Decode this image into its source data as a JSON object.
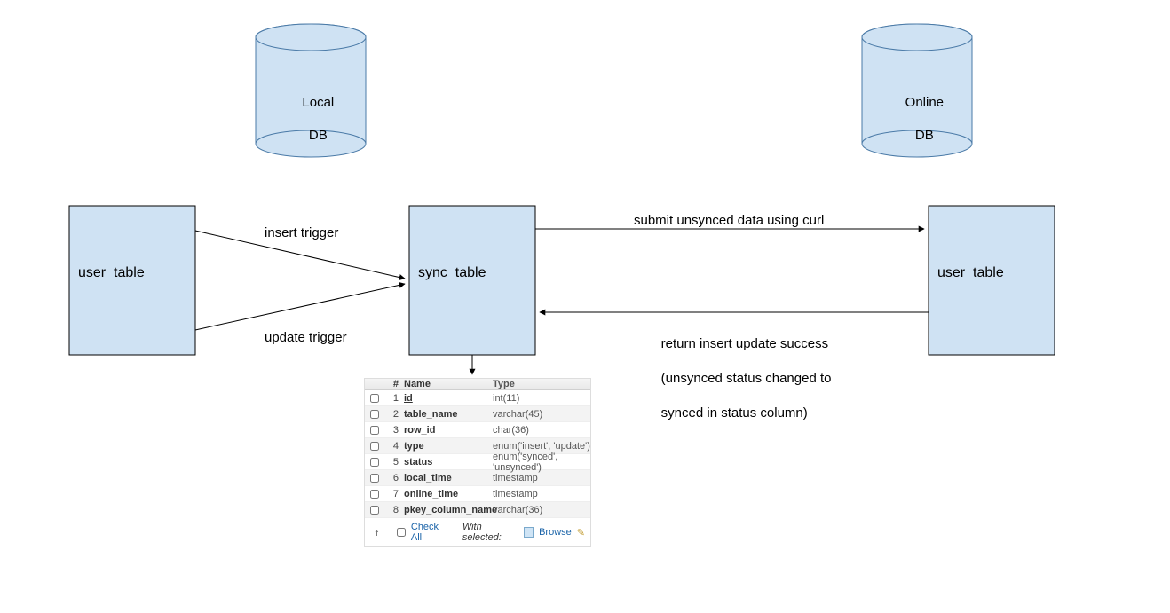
{
  "cylinders": {
    "local": {
      "line1": "Local",
      "line2": "DB"
    },
    "online": {
      "line1": "Online",
      "line2": "DB"
    }
  },
  "boxes": {
    "user_local": {
      "label": "user_table"
    },
    "sync": {
      "label": "sync_table"
    },
    "user_online": {
      "label": "user_table"
    }
  },
  "edges": {
    "insert_trigger": "insert trigger",
    "update_trigger": "update trigger",
    "submit_curl": "submit unsynced data using curl",
    "return_success_l1": "return insert update success",
    "return_success_l2": "(unsynced status changed to",
    "return_success_l3": "synced in status column)"
  },
  "schema": {
    "headers": {
      "num": "#",
      "name": "Name",
      "type": "Type"
    },
    "rows": [
      {
        "n": "1",
        "name": "id",
        "type": "int(11)",
        "underline": true
      },
      {
        "n": "2",
        "name": "table_name",
        "type": "varchar(45)"
      },
      {
        "n": "3",
        "name": "row_id",
        "type": "char(36)"
      },
      {
        "n": "4",
        "name": "type",
        "type": "enum('insert', 'update')"
      },
      {
        "n": "5",
        "name": "status",
        "type": "enum('synced', 'unsynced')"
      },
      {
        "n": "6",
        "name": "local_time",
        "type": "timestamp"
      },
      {
        "n": "7",
        "name": "online_time",
        "type": "timestamp"
      },
      {
        "n": "8",
        "name": "pkey_column_name",
        "type": "varchar(36)"
      }
    ],
    "footer": {
      "check_all": "Check All",
      "with_selected": "With selected:",
      "browse": "Browse"
    }
  },
  "colors": {
    "fill": "#cfe2f3",
    "stroke": "#4a7aa7",
    "black": "#000000"
  }
}
